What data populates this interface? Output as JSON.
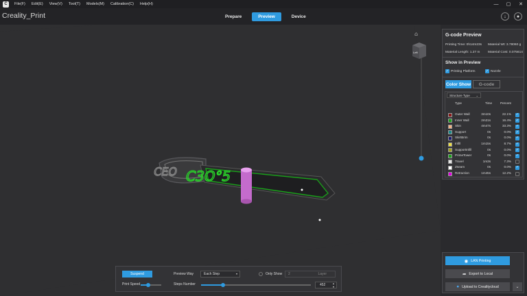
{
  "menubar": {
    "items": [
      "File(F)",
      "Edit(E)",
      "View(V)",
      "Tool(T)",
      "Models(M)",
      "Calibration(C)",
      "Help(H)"
    ],
    "window_buttons": [
      "—",
      "▢",
      "✕"
    ]
  },
  "app": {
    "title": "Creality_Print",
    "tabs": [
      "Prepare",
      "Preview",
      "Device"
    ],
    "active_tab": "Preview"
  },
  "viewcube": {
    "face_label": "Left"
  },
  "gcode_preview": {
    "title": "G-code Preview",
    "printing_time": "Printing Time: 0h14m23s",
    "material_weight": "Material Wt: 3.78060 g",
    "material_length": "Material Length: 1.27 m",
    "material_cost": "Material Cost: 0.075614",
    "show_title": "Show in Preview",
    "show_platform": "Printing Platform",
    "show_nozzle": "Nozzle",
    "color_show_label": "Color Show",
    "gcode_label": "G-code",
    "structure_type": "Structure Type",
    "headers": {
      "type": "Type",
      "time": "Time",
      "percent": "Percent"
    },
    "legend": [
      {
        "name": "Outer Wall",
        "time": "3m10s",
        "percent": "22.1%",
        "color": "#8b1a1a",
        "checked": true
      },
      {
        "name": "Inner Wall",
        "time": "2m21s",
        "percent": "16.4%",
        "color": "#1aa01a",
        "checked": true
      },
      {
        "name": "Skin",
        "time": "4m47s",
        "percent": "33.3%",
        "color": "#f4b183",
        "checked": true
      },
      {
        "name": "Support",
        "time": "0s",
        "percent": "0.0%",
        "color": "#1a8a8a",
        "checked": true
      },
      {
        "name": "SkirtBrim",
        "time": "0s",
        "percent": "0.0%",
        "color": "#1a1a6e",
        "checked": true
      },
      {
        "name": "Infill",
        "time": "1m15s",
        "percent": "8.7%",
        "color": "#f0e040",
        "checked": true
      },
      {
        "name": "SupportInfill",
        "time": "0s",
        "percent": "0.0%",
        "color": "#a0a01a",
        "checked": true
      },
      {
        "name": "PrimeTower",
        "time": "0s",
        "percent": "0.0%",
        "color": "#1aa01a",
        "checked": true
      },
      {
        "name": "Travel",
        "time": "1m3s",
        "percent": "7.3%",
        "color": "#e6e6e6",
        "checked": false
      },
      {
        "name": "Zseam",
        "time": "0s",
        "percent": "0.0%",
        "color": "#ffffff",
        "checked": true
      },
      {
        "name": "Retraction",
        "time": "1m45s",
        "percent": "12.2%",
        "color": "#e600e6",
        "checked": false
      }
    ]
  },
  "bottom_controls": {
    "suspend_label": "Suspend",
    "preview_way_label": "Preview Way",
    "preview_way_value": "Each Step",
    "only_show_label": "Only Show",
    "only_show_value": "2",
    "layer_label": "Layer",
    "print_speed_label": "Print Speed",
    "steps_number_label": "Steps Number",
    "steps_value": "452",
    "steps_progress": 0.2
  },
  "export": {
    "lan_printing": "LAN Printing",
    "export_local": "Export to Local",
    "upload_cloud": "Upload to Crealitycloud"
  }
}
